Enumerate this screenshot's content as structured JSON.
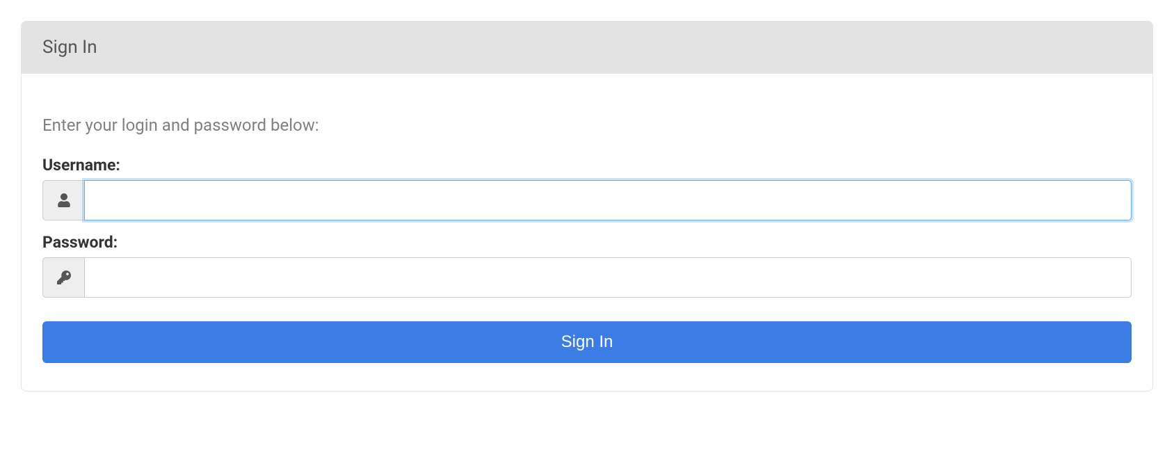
{
  "card": {
    "header_title": "Sign In",
    "instruction": "Enter your login and password below:",
    "username_label": "Username:",
    "username_value": "",
    "password_label": "Password:",
    "password_value": "",
    "submit_label": "Sign In"
  }
}
